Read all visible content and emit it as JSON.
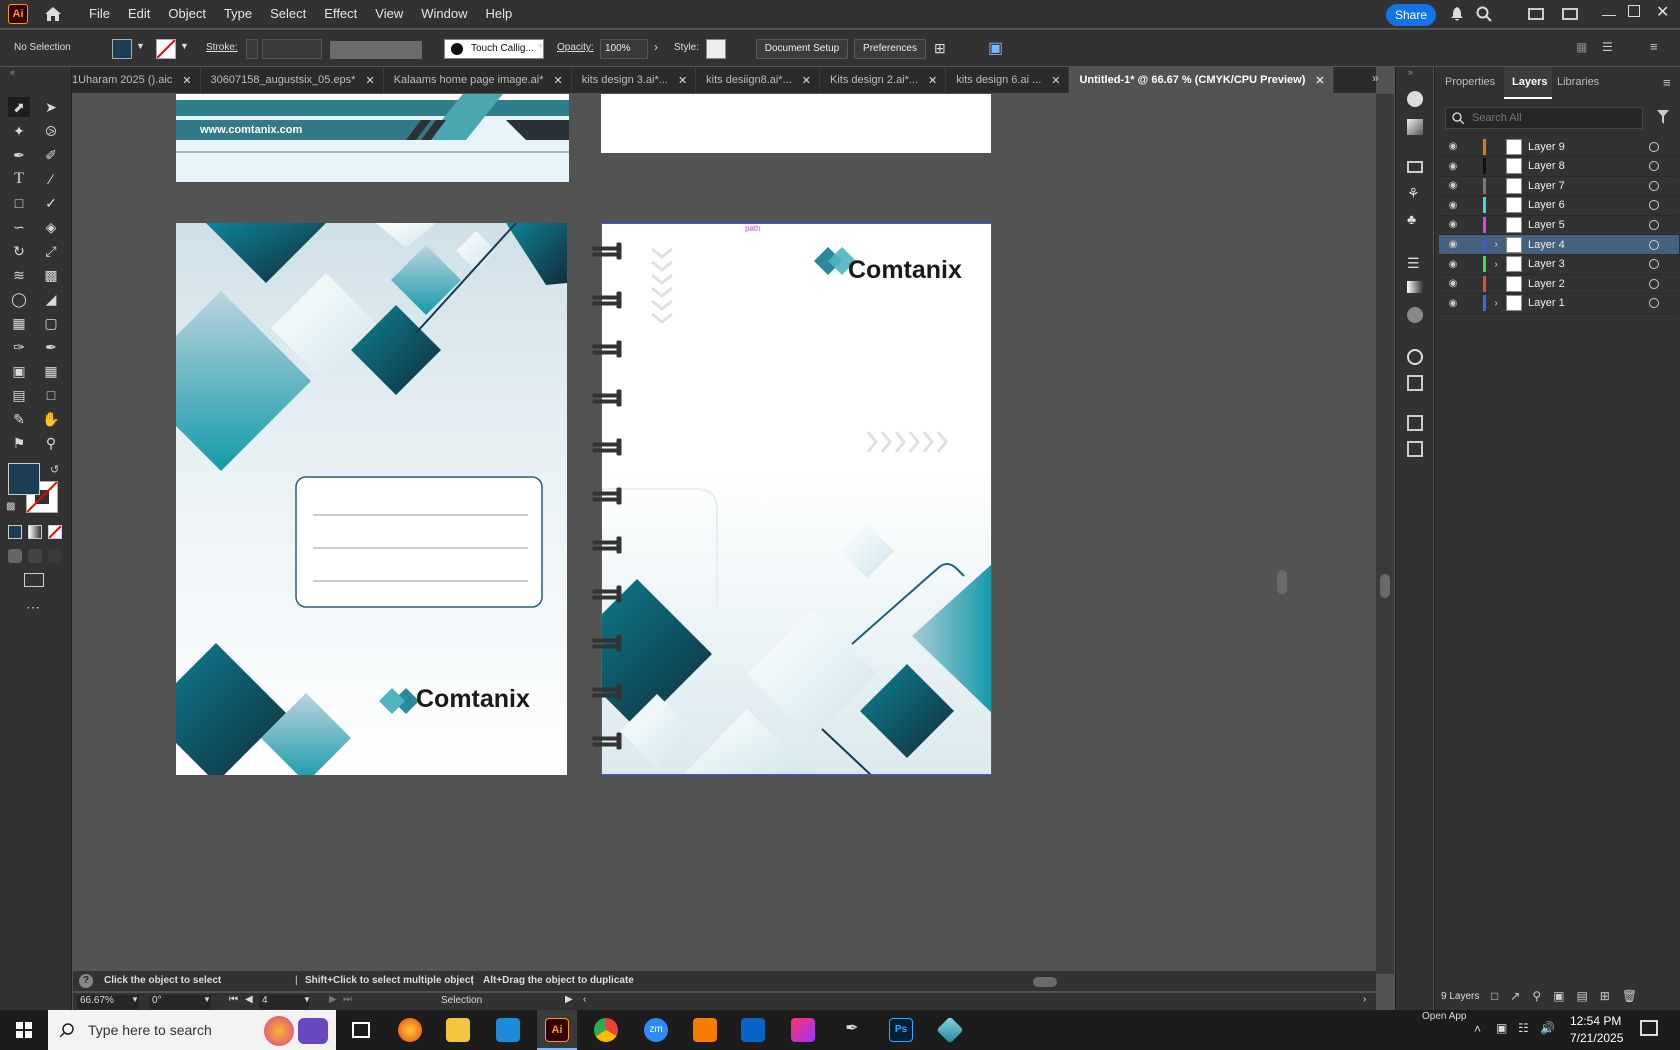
{
  "app": {
    "logo": "Ai",
    "share_label": "Share"
  },
  "menu": [
    "File",
    "Edit",
    "Object",
    "Type",
    "Select",
    "Effect",
    "View",
    "Window",
    "Help"
  ],
  "control": {
    "selection": "No Selection",
    "stroke_label": "Stroke:",
    "brush": "Touch Callig...",
    "opacity_label": "Opacity:",
    "opacity_value": "100%",
    "style_label": "Style:",
    "document_setup": "Document Setup",
    "preferences": "Preferences"
  },
  "tabs": [
    {
      "label": "1Uharam 2025 ().aic",
      "active": false
    },
    {
      "label": "30607158_augustsix_05.eps*",
      "active": false
    },
    {
      "label": "Kalaams home page image.ai*",
      "active": false
    },
    {
      "label": "kits design 3.ai*...",
      "active": false
    },
    {
      "label": "kits desiign8.ai*...",
      "active": false
    },
    {
      "label": "Kits design 2.ai*...",
      "active": false
    },
    {
      "label": "kits design 6.ai ...",
      "active": false
    },
    {
      "label": "Untitled-1* @ 66.67 % (CMYK/CPU Preview)",
      "active": true
    }
  ],
  "artwork": {
    "url": "www.comtanix.com",
    "brand": "Comtanix",
    "path_label": "path"
  },
  "panel": {
    "tabs": [
      "Properties",
      "Layers",
      "Libraries"
    ],
    "active_tab": "Layers",
    "search_placeholder": "Search All",
    "layers": [
      {
        "name": "Layer 9",
        "color": "#e87511",
        "expandable": false,
        "selected": false
      },
      {
        "name": "Layer 8",
        "color": "#111111",
        "expandable": false,
        "selected": false
      },
      {
        "name": "Layer 7",
        "color": "#7a7a7a",
        "expandable": false,
        "selected": false
      },
      {
        "name": "Layer 6",
        "color": "#2fe0e6",
        "expandable": false,
        "selected": false
      },
      {
        "name": "Layer 5",
        "color": "#e044e8",
        "expandable": false,
        "selected": false
      },
      {
        "name": "Layer 4",
        "color": "#3c56e6",
        "expandable": true,
        "selected": true
      },
      {
        "name": "Layer 3",
        "color": "#3de04a",
        "expandable": true,
        "selected": false
      },
      {
        "name": "Layer 2",
        "color": "#e84a3a",
        "expandable": false,
        "selected": false
      },
      {
        "name": "Layer 1",
        "color": "#3a66e8",
        "expandable": true,
        "selected": false
      }
    ],
    "layer_count": "9 Layers"
  },
  "status": {
    "hint_1": "Click the object to select",
    "hint_2": "Shift+Click to select multiple object",
    "hint_3": "Alt+Drag the object to duplicate",
    "zoom": "66.67%",
    "rotation": "0°",
    "artboard": "4",
    "tool": "Selection"
  },
  "taskbar": {
    "search_placeholder": "Type here to search",
    "time": "12:54 PM",
    "date": "7/21/2025",
    "open_app": "Open App"
  },
  "colors": {
    "accent": "#1473e6",
    "teal": "#0c7f90",
    "dark_teal": "#153e4f",
    "fill_swatch": "#1d3d55"
  }
}
